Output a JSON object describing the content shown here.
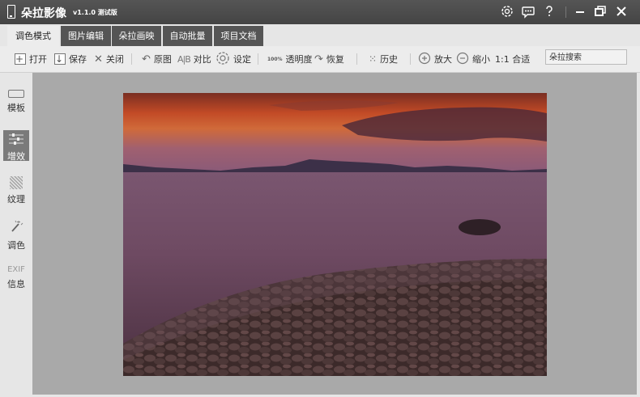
{
  "app": {
    "title": "朵拉影像",
    "version": "v1.1.0 测试版"
  },
  "tabs": [
    {
      "label": "调色模式"
    },
    {
      "label": "图片编辑"
    },
    {
      "label": "朵拉画映"
    },
    {
      "label": "自动批量"
    },
    {
      "label": "项目文档"
    }
  ],
  "toolbar": {
    "open": "打开",
    "save": "保存",
    "close": "关闭",
    "original": "原图",
    "compare": "对比",
    "settings": "设定",
    "opacity": "透明度",
    "restore": "恢复",
    "history": "历史",
    "zoom_in": "放大",
    "zoom_out": "缩小",
    "fit": "1:1 合适",
    "opacity_badge": "100%"
  },
  "search": {
    "value": "朵拉搜索"
  },
  "sidebar": {
    "items": [
      {
        "label": "模板"
      },
      {
        "label": "增效"
      },
      {
        "label": "纹理"
      },
      {
        "label": "调色"
      },
      {
        "label": "信息",
        "icon_text": "EXIF"
      }
    ]
  },
  "colors": {
    "titlebar": "#4a4a4a",
    "tab_inactive": "#555555",
    "canvas": "#a9a9a9",
    "active_side": "#7a7a7a"
  }
}
